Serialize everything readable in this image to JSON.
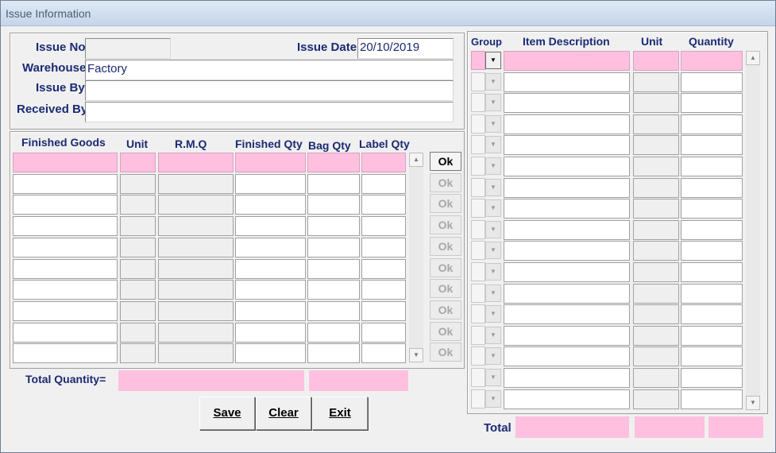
{
  "window": {
    "title": "Issue Information"
  },
  "header": {
    "issue_no_label": "Issue No",
    "issue_no_value": "",
    "issue_date_label": "Issue Date",
    "issue_date_value": "20/10/2019",
    "warehouse_label": "Warehouse",
    "warehouse_value": "Factory",
    "issue_by_label": "Issue By",
    "issue_by_value": "",
    "received_by_label": "Received By",
    "received_by_value": ""
  },
  "finished_goods": {
    "columns": [
      "Finished Goods",
      "Unit",
      "R.M.Q",
      "Finished Qty",
      "Bag Qty",
      "Label Qty"
    ],
    "row_count": 10,
    "ok_label": "Ok",
    "total_label": "Total Quantity="
  },
  "items": {
    "columns": [
      "Group",
      "Item Description",
      "Unit",
      "Quantity"
    ],
    "row_count": 17,
    "total_label": "Total"
  },
  "buttons": {
    "save_label": "Save",
    "clear_label": "Clear",
    "exit_label": "Exit"
  },
  "colors": {
    "highlight": "#ffc0df",
    "label_text": "#1b2a73"
  },
  "icons": [
    "dropdown-arrow-icon",
    "scroll-up-icon",
    "scroll-down-icon"
  ]
}
